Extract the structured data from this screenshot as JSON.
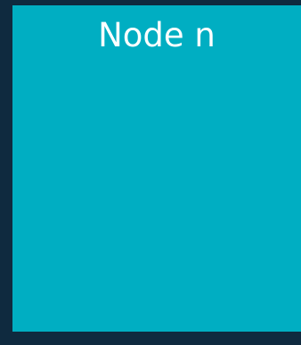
{
  "diagram": {
    "node": {
      "title": "Node n"
    }
  },
  "colors": {
    "background": "#0f2a3f",
    "node_fill": "#00aec2",
    "node_text": "#ffffff"
  }
}
